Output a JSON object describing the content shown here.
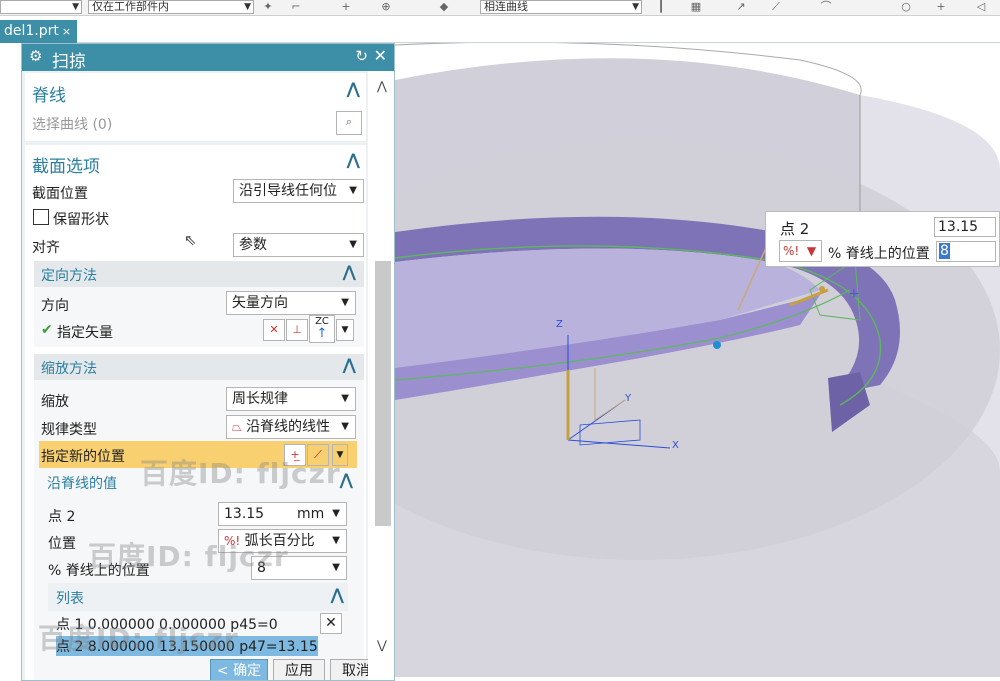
{
  "toolbar": {
    "filter_select": "仅在工作部件内",
    "curve_rule_select": "相连曲线"
  },
  "tab": {
    "label": "del1.prt",
    "close": "×"
  },
  "dialog": {
    "title": "扫掠",
    "spine": {
      "header": "脊线",
      "select_curve": "选择曲线 (0)"
    },
    "section_options": {
      "header": "截面选项",
      "section_position_label": "截面位置",
      "section_position_value": "沿引导线任何位",
      "keep_shape_label": "保留形状",
      "keep_shape_checked": false,
      "align_label": "对齐",
      "align_value": "参数",
      "orientation": {
        "header": "定向方法",
        "direction_label": "方向",
        "direction_value": "矢量方向",
        "specify_vector_label": "指定矢量",
        "vector_icon_text": "ZC"
      },
      "scaling": {
        "header": "缩放方法",
        "scale_label": "缩放",
        "scale_value": "周长规律",
        "law_type_label": "规律类型",
        "law_type_value": "沿脊线的线性",
        "new_location_label": "指定新的位置",
        "values_along_spine": {
          "header": "沿脊线的值",
          "point_label": "点 2",
          "point_value": "13.15",
          "point_unit": "mm",
          "position_label": "位置",
          "position_value": "弧长百分比",
          "percent_label": "% 脊线上的位置",
          "percent_value": "8"
        },
        "list": {
          "header": "列表",
          "rows": [
            "点 1  0.000000  0.000000  p45=0",
            "点 2  8.000000  13.150000  p47=13.15"
          ]
        }
      }
    },
    "buttons": {
      "ok": "< 确定 >",
      "apply": "应用",
      "cancel": "取消"
    }
  },
  "floater": {
    "point_label": "点 2",
    "point_value": "13.15",
    "percent_label": "% 脊线上的位置",
    "percent_value": "8"
  },
  "viewport": {
    "axis_z": "Z",
    "axis_y": "Y",
    "axis_x": "X"
  },
  "watermarks": [
    "百度ID: fljczr",
    "百度ID: fljczr",
    "百度ID: fljczr"
  ],
  "colors": {
    "accent": "#3d8ea7",
    "highlight": "#f8d070",
    "part": "#9b8fcf"
  }
}
